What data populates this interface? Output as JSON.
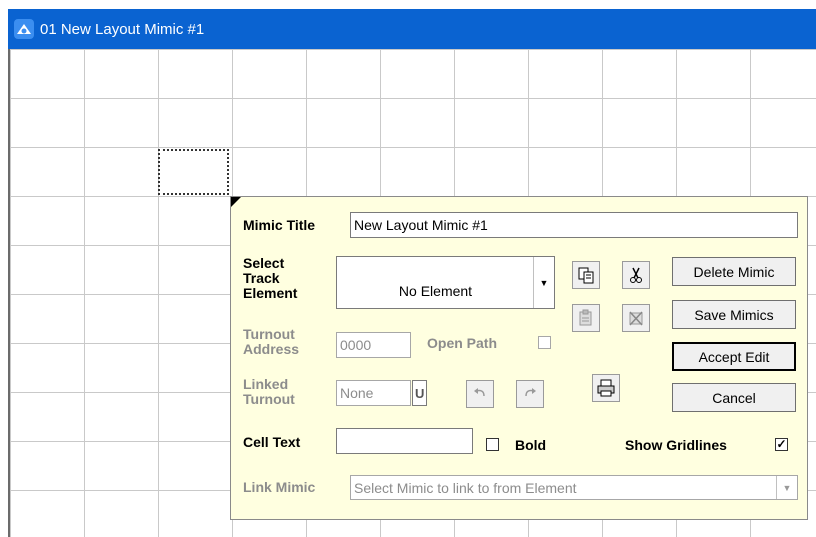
{
  "window": {
    "title": "01 New Layout Mimic #1"
  },
  "panel": {
    "mimic_title_label": "Mimic Title",
    "mimic_title_value": "New Layout Mimic #1",
    "select_track_label_1": "Select",
    "select_track_label_2": "Track",
    "select_track_label_3": "Element",
    "track_element_value": "No Element",
    "turnout_address_label_1": "Turnout",
    "turnout_address_label_2": "Address",
    "turnout_address_value": "0000",
    "open_path_label": "Open Path",
    "linked_turnout_label_1": "Linked",
    "linked_turnout_label_2": "Turnout",
    "linked_turnout_value": "None",
    "linked_turnout_suffix": "U",
    "cell_text_label": "Cell Text",
    "cell_text_value": "",
    "bold_label": "Bold",
    "bold_checked": false,
    "show_gridlines_label": "Show Gridlines",
    "show_gridlines_checked": true,
    "link_mimic_label": "Link Mimic",
    "link_mimic_value": "Select Mimic to link to from Element",
    "buttons": {
      "delete_mimic": "Delete Mimic",
      "save_mimics": "Save Mimics",
      "accept_edit": "Accept Edit",
      "cancel": "Cancel"
    },
    "icons": [
      "copy-icon",
      "cut-icon",
      "paste-icon",
      "delete-element-icon",
      "undo-icon",
      "redo-icon",
      "print-icon"
    ],
    "checkmark": "✓"
  },
  "colors": {
    "titlebar": "#0a63d1",
    "panel_bg": "#ffffe0"
  }
}
